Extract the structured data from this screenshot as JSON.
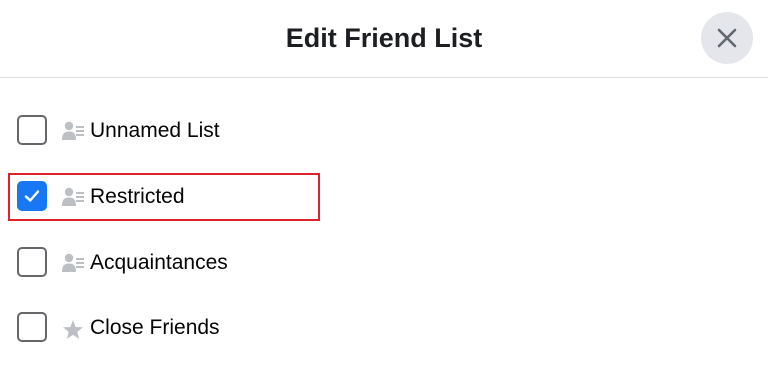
{
  "dialog": {
    "title": "Edit Friend List",
    "close_icon": "close-icon"
  },
  "lists": [
    {
      "label": "Unnamed List",
      "checked": false,
      "icon": "friend-list-icon"
    },
    {
      "label": "Restricted",
      "checked": true,
      "icon": "friend-list-icon"
    },
    {
      "label": "Acquaintances",
      "checked": false,
      "icon": "friend-list-icon"
    },
    {
      "label": "Close Friends",
      "checked": false,
      "icon": "star-icon"
    }
  ],
  "colors": {
    "accent": "#1877f2",
    "highlight": "#e0202a",
    "icon_gray": "#bcc0c4",
    "close_bg": "#e4e6eb"
  }
}
